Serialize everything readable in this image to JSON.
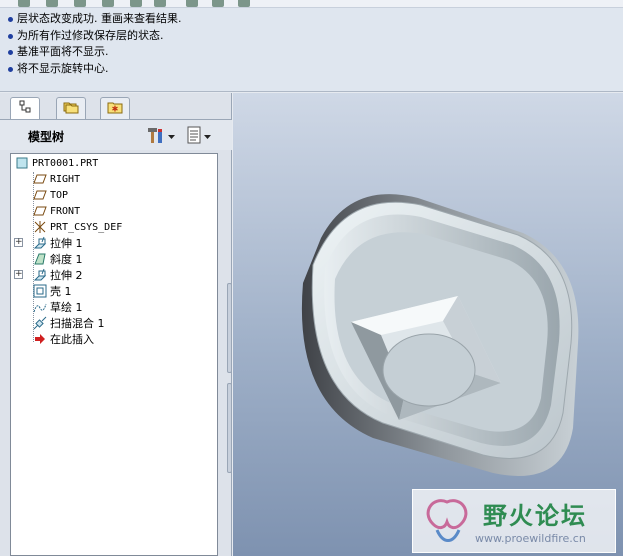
{
  "messages": [
    "层状态改变成功. 重画来查看结果.",
    "为所有作过修改保存层的状态.",
    "基准平面将不显示.",
    "将不显示旋转中心."
  ],
  "tabs": [
    {
      "name": "model-tree",
      "icon": "tree-icon"
    },
    {
      "name": "folder-browser",
      "icon": "folders-icon"
    },
    {
      "name": "favorites",
      "icon": "star-folder-icon"
    }
  ],
  "tree_header": {
    "title": "模型树"
  },
  "tree": [
    {
      "label": "PRT0001.PRT",
      "icon": "part-icon",
      "expandable": false
    },
    {
      "label": "RIGHT",
      "icon": "datum-plane-icon",
      "expandable": false
    },
    {
      "label": "TOP",
      "icon": "datum-plane-icon",
      "expandable": false
    },
    {
      "label": "FRONT",
      "icon": "datum-plane-icon",
      "expandable": false
    },
    {
      "label": "PRT_CSYS_DEF",
      "icon": "csys-icon",
      "expandable": false
    },
    {
      "label": "拉伸 1",
      "icon": "extrude-icon",
      "expandable": true
    },
    {
      "label": "斜度 1",
      "icon": "draft-icon",
      "expandable": false
    },
    {
      "label": "拉伸 2",
      "icon": "extrude-icon",
      "expandable": true
    },
    {
      "label": "壳 1",
      "icon": "shell-icon",
      "expandable": false
    },
    {
      "label": "草绘 1",
      "icon": "sketch-icon",
      "expandable": false
    },
    {
      "label": "扫描混合 1",
      "icon": "swept-blend-icon",
      "expandable": false
    },
    {
      "label": "在此插入",
      "icon": "insert-arrow-icon",
      "expandable": false
    }
  ],
  "watermark": {
    "title": "野火论坛",
    "url": "www.proewildfire.cn"
  },
  "colors": {
    "accent": "#1f3f9f",
    "insert_arrow": "#d02020",
    "watermark_green": "#2f8c52"
  }
}
